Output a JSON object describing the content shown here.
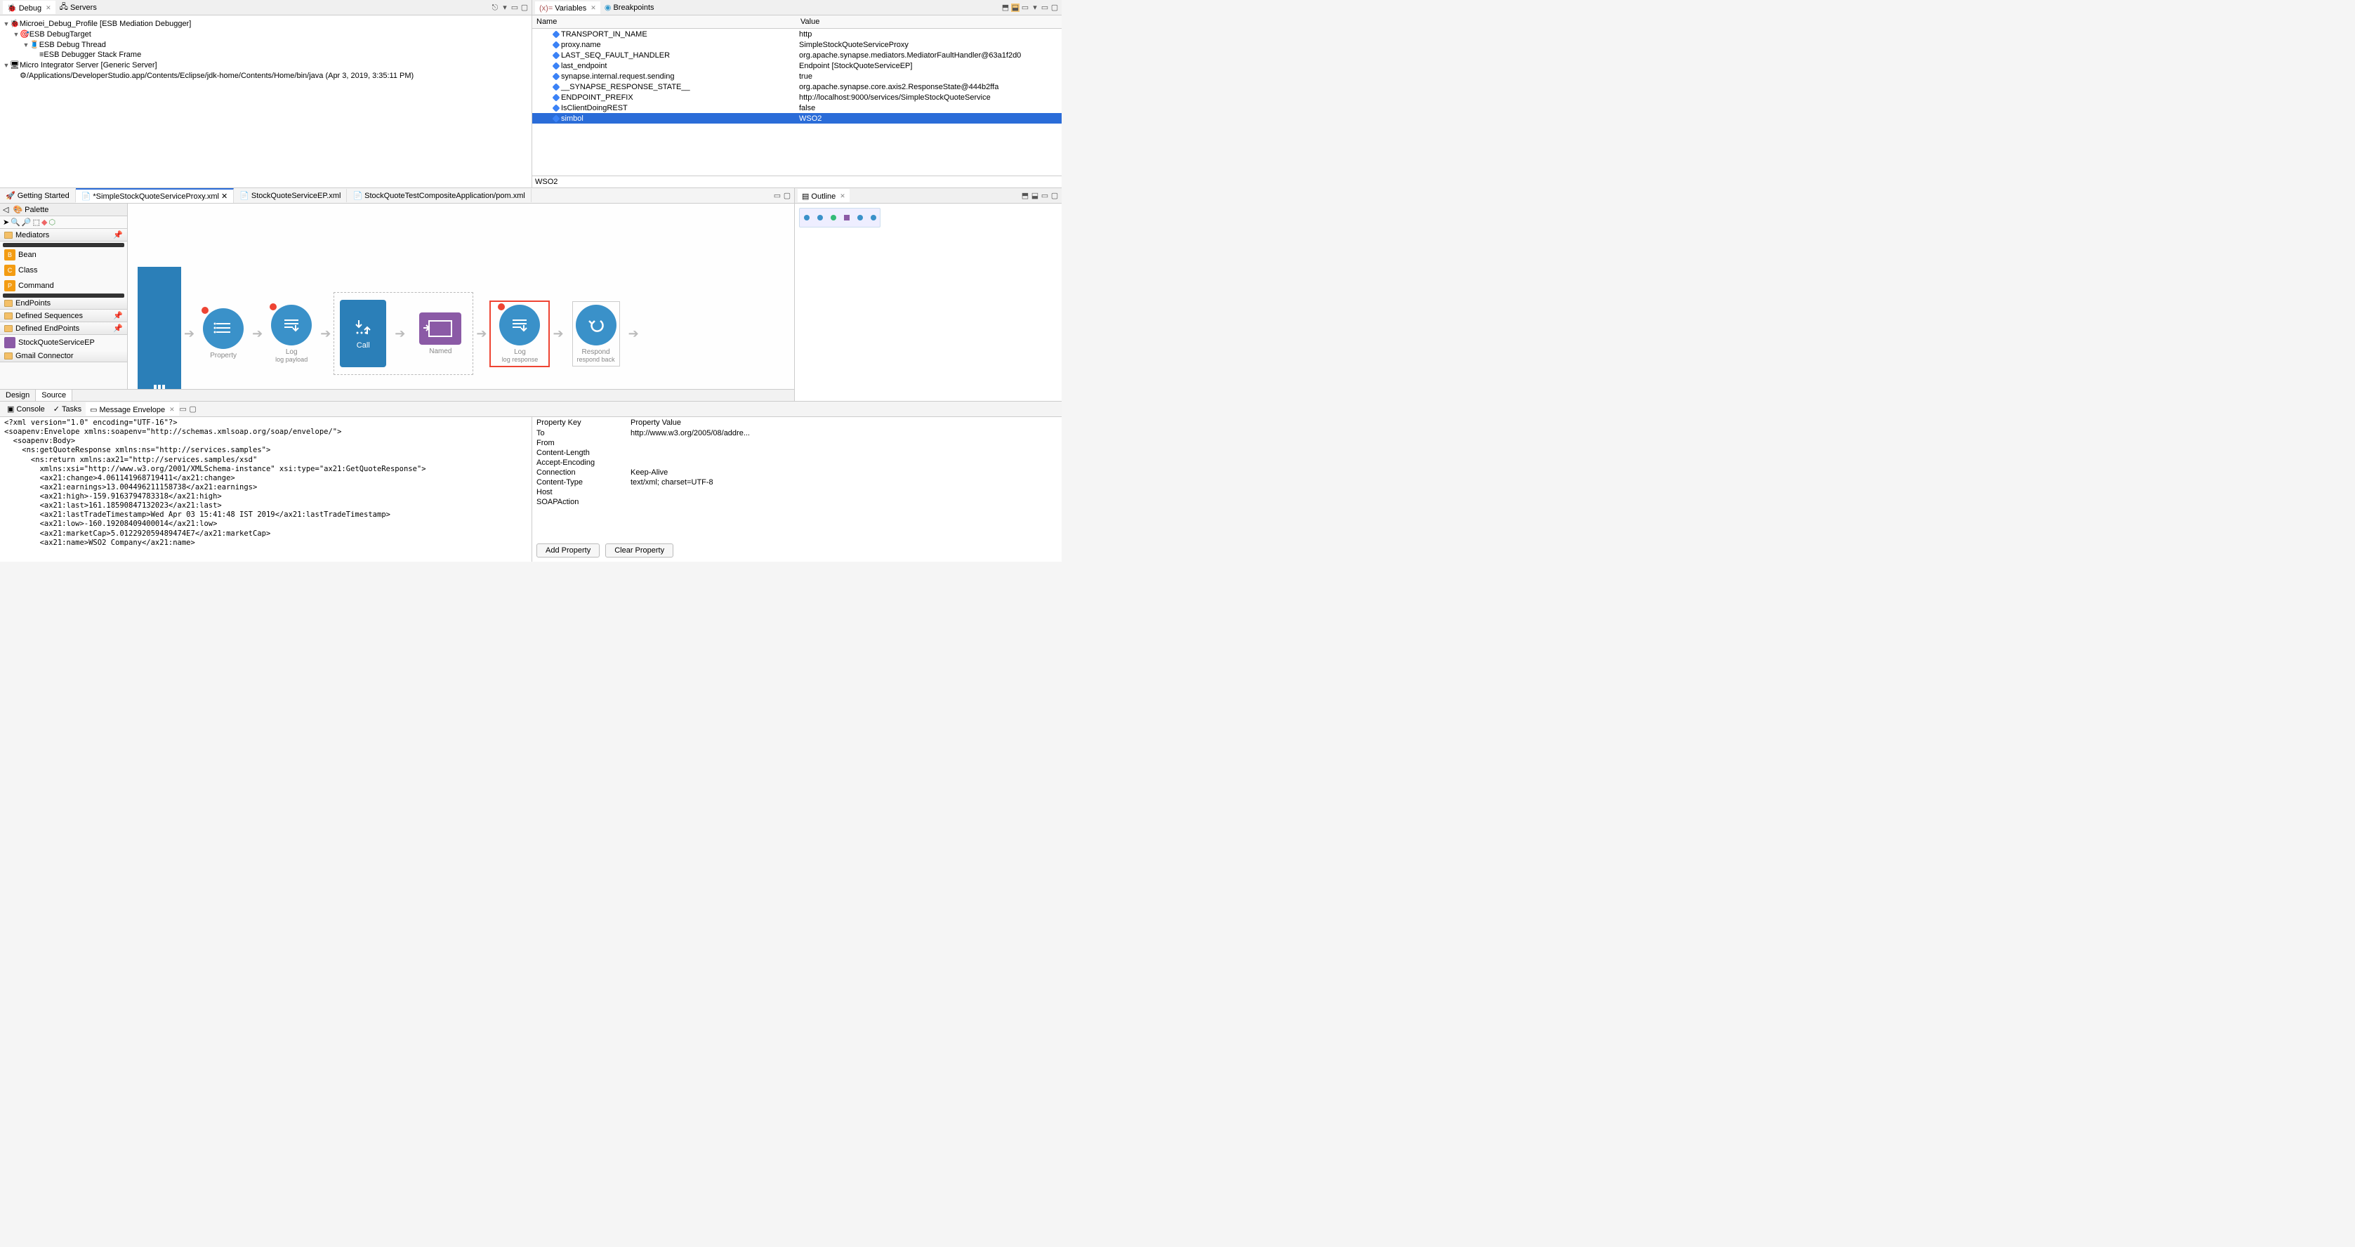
{
  "tabs_top_left": {
    "debug": "Debug",
    "servers": "Servers"
  },
  "tabs_top_right": {
    "variables": "Variables",
    "breakpoints": "Breakpoints"
  },
  "debug_tree": [
    {
      "indent": 0,
      "expand": "▼",
      "icon": "bug",
      "text": "Microei_Debug_Profile [ESB Mediation Debugger]"
    },
    {
      "indent": 1,
      "expand": "▼",
      "icon": "target",
      "text": "ESB DebugTarget"
    },
    {
      "indent": 2,
      "expand": "▼",
      "icon": "thread",
      "text": "ESB Debug Thread"
    },
    {
      "indent": 3,
      "expand": "",
      "icon": "frame",
      "text": "ESB Debugger Stack Frame"
    },
    {
      "indent": 0,
      "expand": "▼",
      "icon": "server",
      "text": "Micro Integrator Server [Generic Server]"
    },
    {
      "indent": 1,
      "expand": "",
      "icon": "gear",
      "text": "/Applications/DeveloperStudio.app/Contents/Eclipse/jdk-home/Contents/Home/bin/java (Apr 3, 2019, 3:35:11 PM)"
    }
  ],
  "vars_cols": {
    "name": "Name",
    "value": "Value"
  },
  "variables": [
    {
      "name": "TRANSPORT_IN_NAME",
      "value": "http"
    },
    {
      "name": "proxy.name",
      "value": "SimpleStockQuoteServiceProxy"
    },
    {
      "name": "LAST_SEQ_FAULT_HANDLER",
      "value": "org.apache.synapse.mediators.MediatorFaultHandler@63a1f2d0"
    },
    {
      "name": "last_endpoint",
      "value": "Endpoint [StockQuoteServiceEP]"
    },
    {
      "nameods": "synapse.internal.request.sending",
      "name": "synapse.internal.request.sending",
      "value": "true"
    },
    {
      "name": "__SYNAPSE_RESPONSE_STATE__",
      "value": "org.apache.synapse.core.axis2.ResponseState@444b2ffa"
    },
    {
      "name": "ENDPOINT_PREFIX",
      "value": "http://localhost:9000/services/SimpleStockQuoteService"
    },
    {
      "name": "IsClientDoingREST",
      "value": "false"
    },
    {
      "name": "simbol",
      "value": "WSO2",
      "selected": true
    }
  ],
  "vars_detail": "WSO2",
  "editor_tabs": [
    {
      "label": "Getting Started",
      "icon": "rocket"
    },
    {
      "label": "*SimpleStockQuoteServiceProxy.xml",
      "icon": "xml",
      "active": true,
      "close": true
    },
    {
      "label": "StockQuoteServiceEP.xml",
      "icon": "xml"
    },
    {
      "label": "StockQuoteTestCompositeApplication/pom.xml",
      "icon": "xml"
    }
  ],
  "palette": {
    "title": "Palette",
    "groups": {
      "mediators": "Mediators",
      "endpoints": "EndPoints",
      "defseq": "Defined Sequences",
      "defep": "Defined EndPoints",
      "gmail": "Gmail Connector"
    },
    "items": {
      "bean": "Bean",
      "class": "Class",
      "command": "Command",
      "stockep": "StockQuoteServiceEP"
    }
  },
  "flow": {
    "property": {
      "label": "Property"
    },
    "log1": {
      "label": "Log",
      "sub": "log payload"
    },
    "call": "Call",
    "named": "Named",
    "log2": {
      "label": "Log",
      "sub": "log response"
    },
    "respond": {
      "label": "Respond",
      "sub": "respond back"
    }
  },
  "design_source": {
    "design": "Design",
    "source": "Source"
  },
  "outline_tab": "Outline",
  "bottom_tabs": {
    "console": "Console",
    "tasks": "Tasks",
    "envelope": "Message Envelope"
  },
  "xml_lines": [
    "<?xml version=\"1.0\" encoding=\"UTF-16\"?>",
    "<soapenv:Envelope xmlns:soapenv=\"http://schemas.xmlsoap.org/soap/envelope/\">",
    "  <soapenv:Body>",
    "    <ns:getQuoteResponse xmlns:ns=\"http://services.samples\">",
    "      <ns:return xmlns:ax21=\"http://services.samples/xsd\"",
    "        xmlns:xsi=\"http://www.w3.org/2001/XMLSchema-instance\" xsi:type=\"ax21:GetQuoteResponse\">",
    "        <ax21:change>4.061141968719411</ax21:change>",
    "        <ax21:earnings>13.004496211158738</ax21:earnings>",
    "        <ax21:high>-159.9163794783318</ax21:high>",
    "        <ax21:last>161.18590847132023</ax21:last>",
    "        <ax21:lastTradeTimestamp>Wed Apr 03 15:41:48 IST 2019</ax21:lastTradeTimestamp>",
    "        <ax21:low>-160.19208409400014</ax21:low>",
    "        <ax21:marketCap>5.012292059489474E7</ax21:marketCap>",
    "        <ax21:name>WSO2 Company</ax21:name>"
  ],
  "props": {
    "header": {
      "k": "Property Key",
      "v": "Property Value"
    },
    "rows": [
      {
        "k": "To",
        "v": "http://www.w3.org/2005/08/addre..."
      },
      {
        "k": "From",
        "v": ""
      },
      {
        "k": "Content-Length",
        "v": ""
      },
      {
        "k": "Accept-Encoding",
        "v": ""
      },
      {
        "k": "Connection",
        "v": "Keep-Alive"
      },
      {
        "k": "Content-Type",
        "v": "text/xml; charset=UTF-8"
      },
      {
        "k": "Host",
        "v": ""
      },
      {
        "k": "SOAPAction",
        "v": ""
      }
    ],
    "buttons": {
      "add": "Add Property",
      "clear": "Clear Property"
    }
  }
}
